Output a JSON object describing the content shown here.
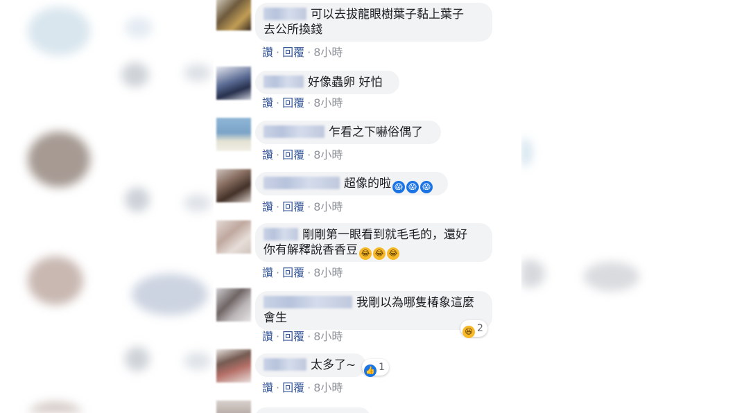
{
  "actions": {
    "like_label": "讚",
    "reply_label": "回覆",
    "separator": "·"
  },
  "comments": [
    {
      "text_line1": "可以去拔龍眼樹葉子黏上葉子",
      "text_line2": "去公所換錢",
      "time": "8小時"
    },
    {
      "text_line1": "好像蟲卵 好怕",
      "time": "8小時"
    },
    {
      "text_line1": "乍看之下嚇俗偶了",
      "time": "8小時"
    },
    {
      "text_line1": "超像的啦",
      "emoji": [
        "scream-emoji",
        "scream-emoji",
        "scream-emoji"
      ],
      "time": "8小時"
    },
    {
      "text_line1": "剛剛第一眼看到就毛毛的，還好",
      "text_line2": "你有解釋說香香豆",
      "emoji": [
        "laugh-emoji",
        "laugh-emoji",
        "laugh-emoji"
      ],
      "time": "8小時"
    },
    {
      "text_line1": "我剛以為哪隻椿象這麼",
      "text_line2": "會生",
      "time": "8小時",
      "reaction_count": "2",
      "reaction_icon": "laugh-reaction-icon"
    },
    {
      "text_line1": "太多了~",
      "time": "8小時",
      "reaction_count": "1",
      "reaction_icon": "like-reaction-icon"
    }
  ]
}
